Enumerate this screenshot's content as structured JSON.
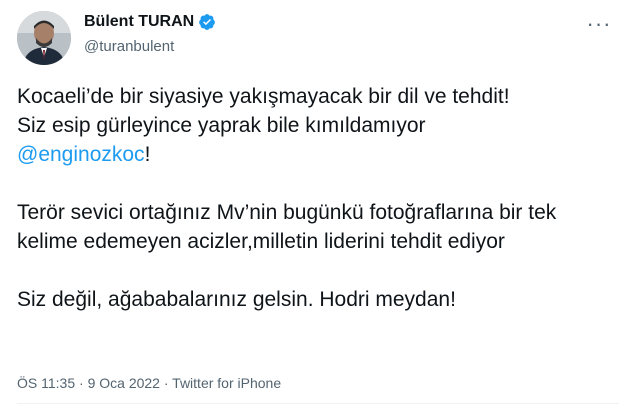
{
  "author": {
    "display_name": "Bülent TURAN",
    "handle": "@turanbulent",
    "avatar_icon": "person-avatar",
    "verified_icon": "verified-badge-icon",
    "verified_color": "#1d9bf0"
  },
  "menu": {
    "more_icon": "more-options-icon",
    "more_glyph": "···"
  },
  "tweet": {
    "line1": "Kocaeli’de bir siyasiye yakışmayacak bir dil ve tehdit!",
    "line2": "Siz esip gürleyince yaprak bile kımıldamıyor",
    "mention": "@enginozkoc",
    "mention_suffix": "!",
    "para2": "Terör sevici ortağınız Mv’nin bugünkü fotoğraflarına bir tek kelime edemeyen acizler,milletin liderini tehdit ediyor",
    "para3": "Siz değil, ağababalarınız gelsin. Hodri meydan!"
  },
  "meta": {
    "time": "ÖS 11:35",
    "separator": " · ",
    "date": "9 Oca 2022",
    "source": "Twitter for iPhone"
  },
  "colors": {
    "link": "#1d9bf0",
    "text": "#0f1419",
    "secondary": "#536471"
  }
}
